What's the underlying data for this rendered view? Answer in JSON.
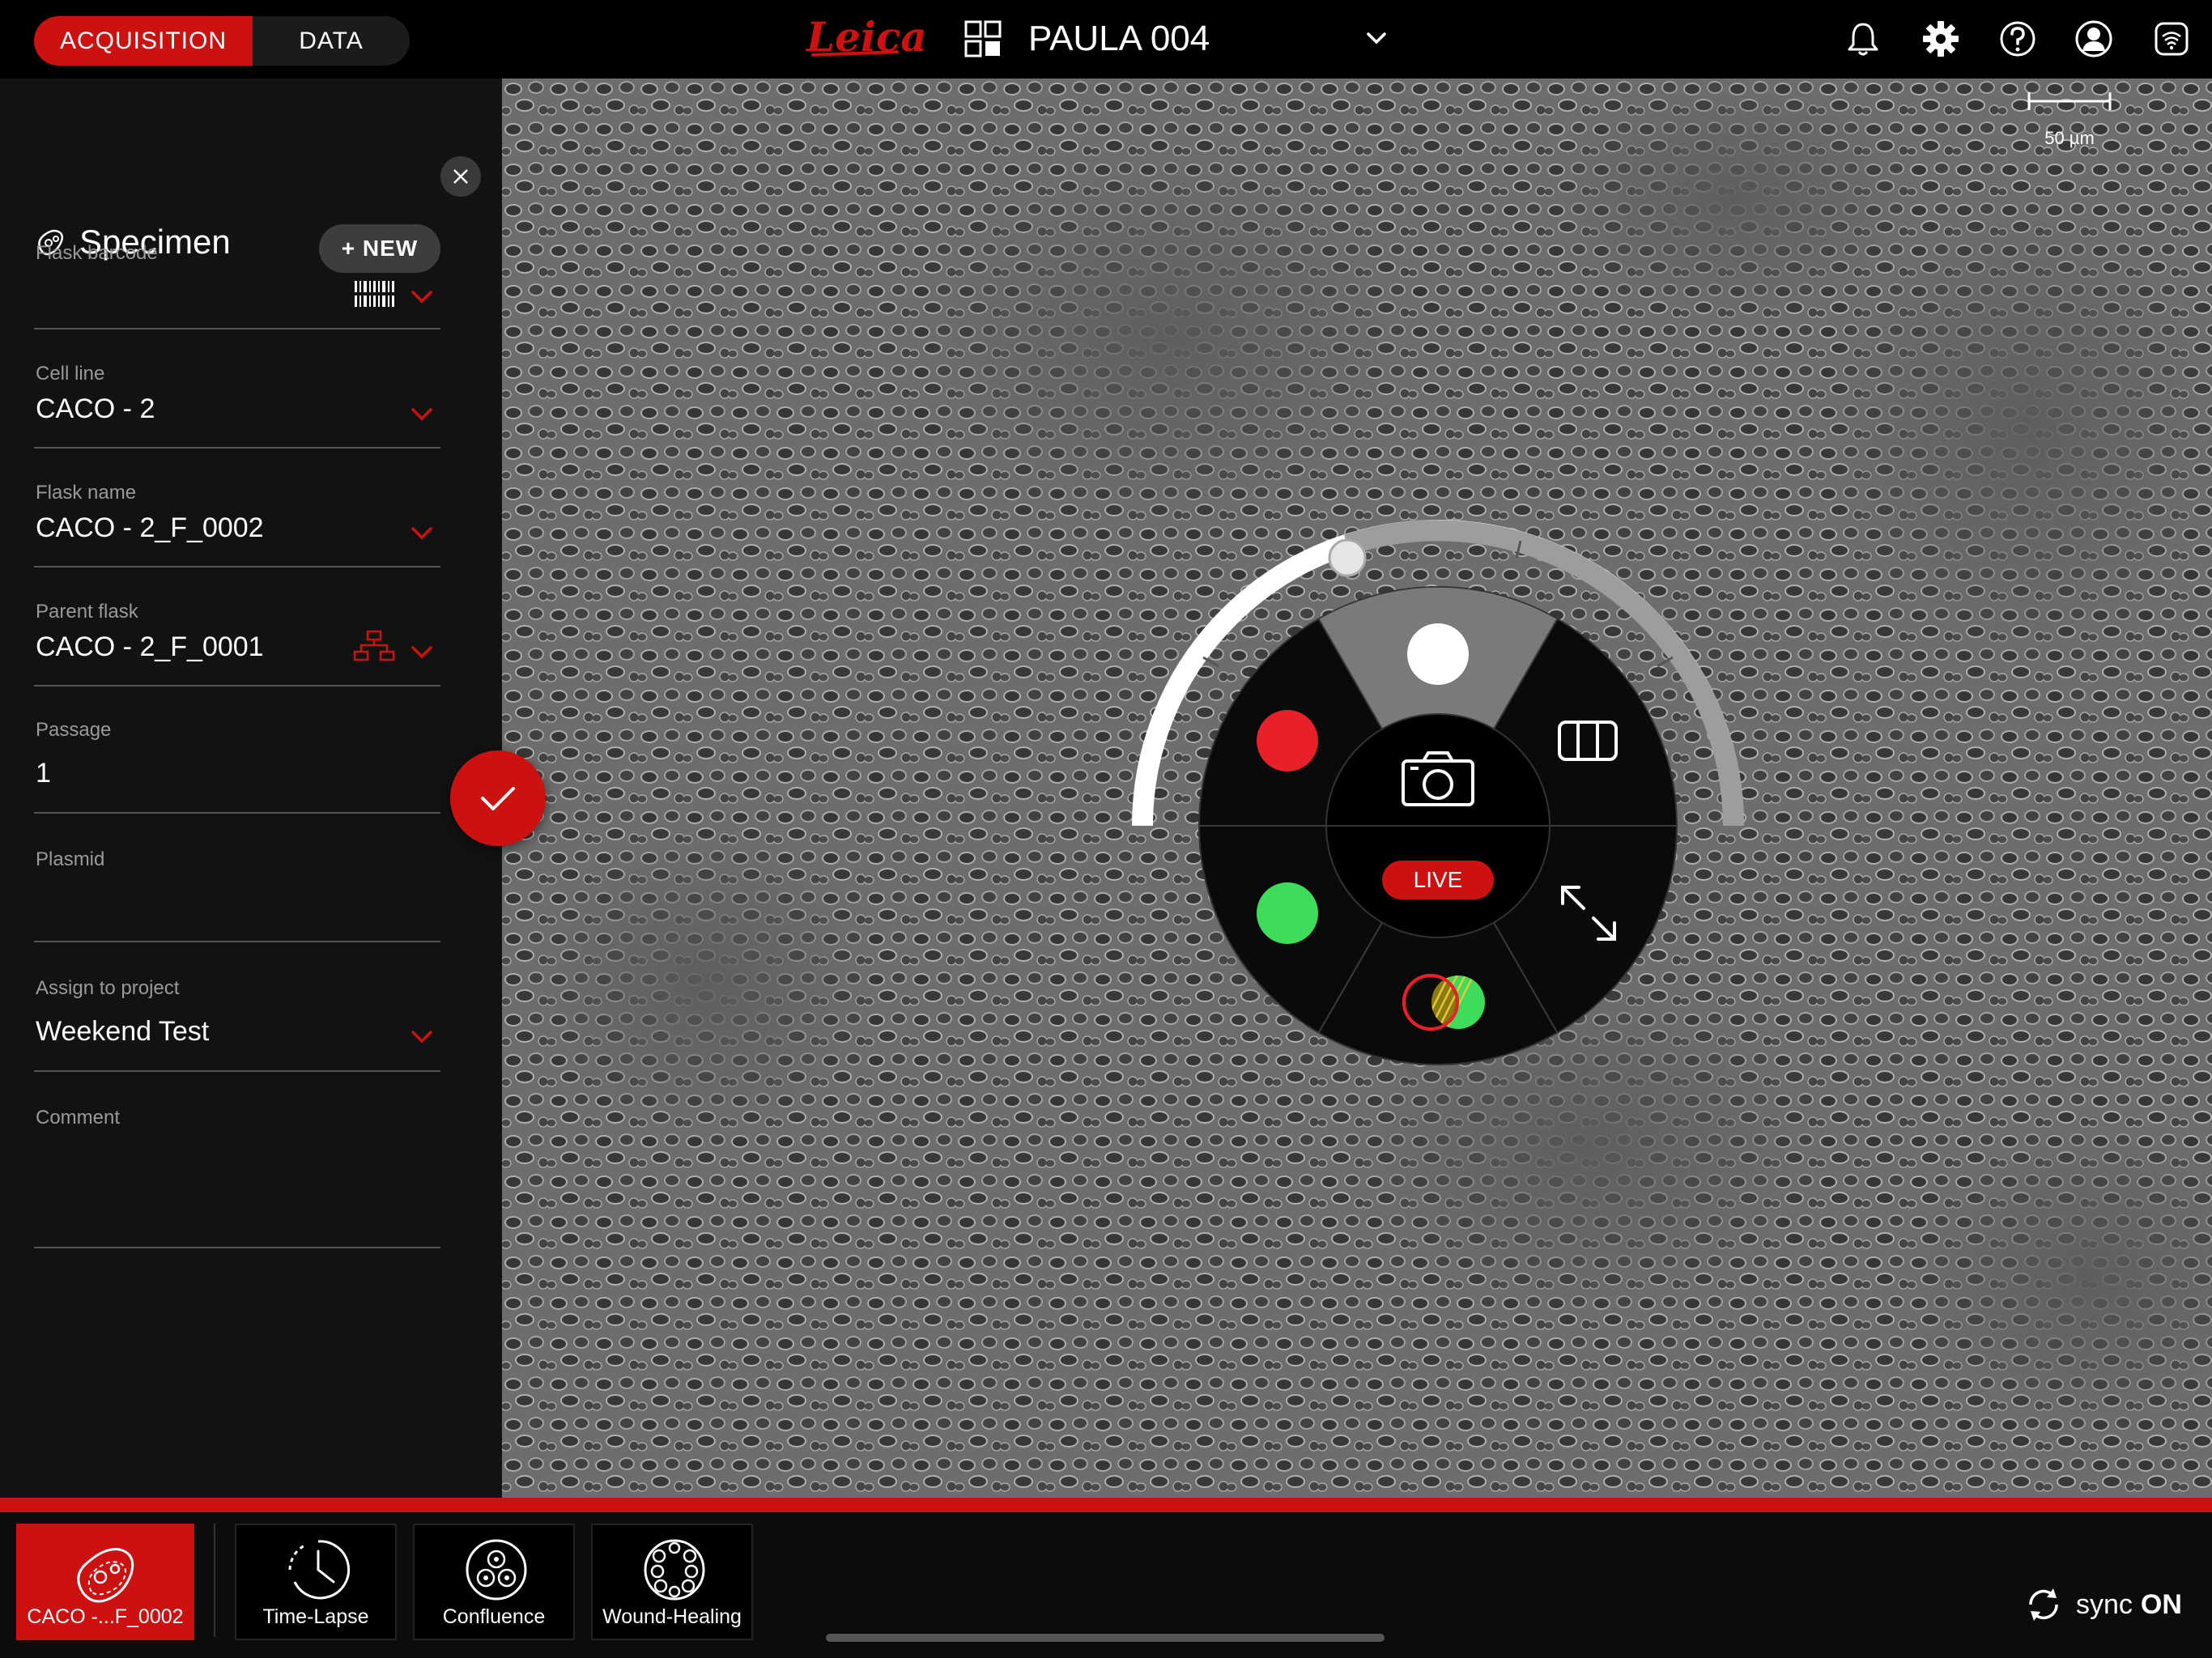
{
  "topbar": {
    "tab_acquisition": "ACQUISITION",
    "tab_data": "DATA",
    "brand": "Leica",
    "instrument_name": "PAULA 004"
  },
  "specimen": {
    "title": "Specimen",
    "new_button": "+ NEW",
    "fields": {
      "flask_barcode": {
        "label": "Flask barcode",
        "value": ""
      },
      "cell_line": {
        "label": "Cell line",
        "value": "CACO - 2"
      },
      "flask_name": {
        "label": "Flask name",
        "value": "CACO - 2_F_0002"
      },
      "parent_flask": {
        "label": "Parent flask",
        "value": "CACO - 2_F_0001"
      },
      "passage": {
        "label": "Passage",
        "value": "1"
      },
      "plasmid": {
        "label": "Plasmid",
        "value": ""
      },
      "project": {
        "label": "Assign to project",
        "value": "Weekend Test"
      },
      "comment": {
        "label": "Comment",
        "value": ""
      }
    }
  },
  "viewer": {
    "scale_label": "50 µm",
    "live_label": "LIVE"
  },
  "bottombar": {
    "tools": [
      {
        "label": "CACO -...F_0002",
        "active": true
      },
      {
        "label": "Time-Lapse",
        "active": false
      },
      {
        "label": "Confluence",
        "active": false
      },
      {
        "label": "Wound-Healing",
        "active": false
      }
    ],
    "sync_label": "sync",
    "sync_state": "ON"
  },
  "colors": {
    "accent": "#cc1111",
    "channel_red": "#e8202a",
    "channel_green": "#3ddc5a",
    "channel_white": "#ffffff"
  }
}
